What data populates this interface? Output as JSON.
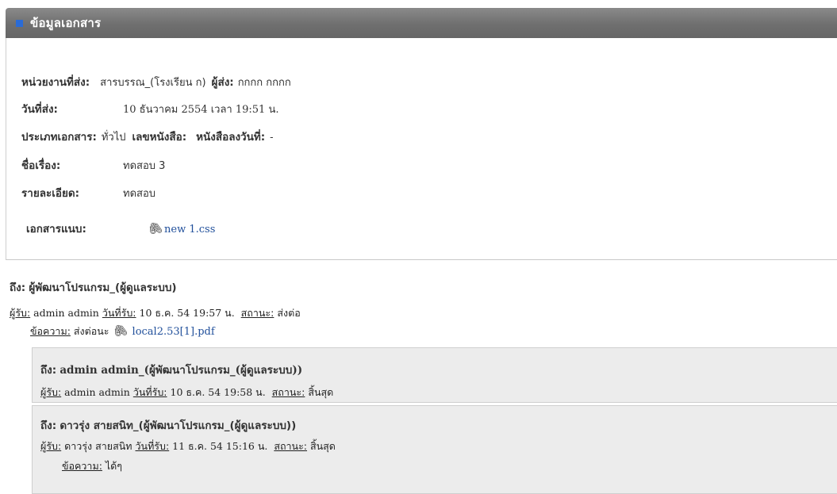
{
  "header": {
    "title": "ข้อมูลเอกสาร"
  },
  "info": {
    "sender_unit_label": "หน่วยงานที่ส่ง:",
    "sender_unit_value": "สารบรรณ_(โรงเรียน ก)",
    "sender_label": "ผู้ส่ง:",
    "sender_value": "กกกก กกกก",
    "date_label": "วันที่ส่ง:",
    "date_value": "10 ธันวาคม 2554 เวลา 19:51 น.",
    "type_label": "ประเภทเอกสาร:",
    "type_value": "ทั่วไป",
    "book_no_label": "เลขหนังสือ:",
    "book_date_label": "หนังสือลงวันที่:",
    "book_date_value": "-",
    "subject_label": "ชื่อเรื่อง:",
    "subject_value": "ทดสอบ 3",
    "detail_label": "รายละเอียด:",
    "detail_value": "ทดสอบ",
    "attach_label": "เอกสารแนบ:",
    "attach_file": "new 1.css"
  },
  "recipients": [
    {
      "to_label": "ถึง:",
      "to_value": "ผู้พัฒนาโปรแกรม_(ผู้ดูแลระบบ)",
      "receiver_label": "ผู้รับ:",
      "receiver_value": "admin admin",
      "recv_date_label": "วันที่รับ:",
      "recv_date_value": "10 ธ.ค. 54 19:57 น.",
      "status_label": "สถานะ:",
      "status_value": "ส่งต่อ",
      "message_label": "ข้อความ:",
      "message_value": "ส่งต่อนะ",
      "message_file": "local2.53[1].pdf"
    }
  ],
  "forwarded": [
    {
      "to_label": "ถึง:",
      "to_value": "admin admin_(ผู้พัฒนาโปรแกรม_(ผู้ดูแลระบบ))",
      "receiver_label": "ผู้รับ:",
      "receiver_value": "admin admin",
      "recv_date_label": "วันที่รับ:",
      "recv_date_value": "10 ธ.ค. 54 19:58 น.",
      "status_label": "สถานะ:",
      "status_value": "สิ้นสุด"
    },
    {
      "to_label": "ถึง:",
      "to_value": "ดาวรุ่ง สายสนิท_(ผู้พัฒนาโปรแกรม_(ผู้ดูแลระบบ))",
      "receiver_label": "ผู้รับ:",
      "receiver_value": "ดาวรุ่ง สายสนิท",
      "recv_date_label": "วันที่รับ:",
      "recv_date_value": "11 ธ.ค. 54 15:16 น.",
      "status_label": "สถานะ:",
      "status_value": "สิ้นสุด",
      "message_label": "ข้อความ:",
      "message_value": "ได้ๆ"
    }
  ]
}
